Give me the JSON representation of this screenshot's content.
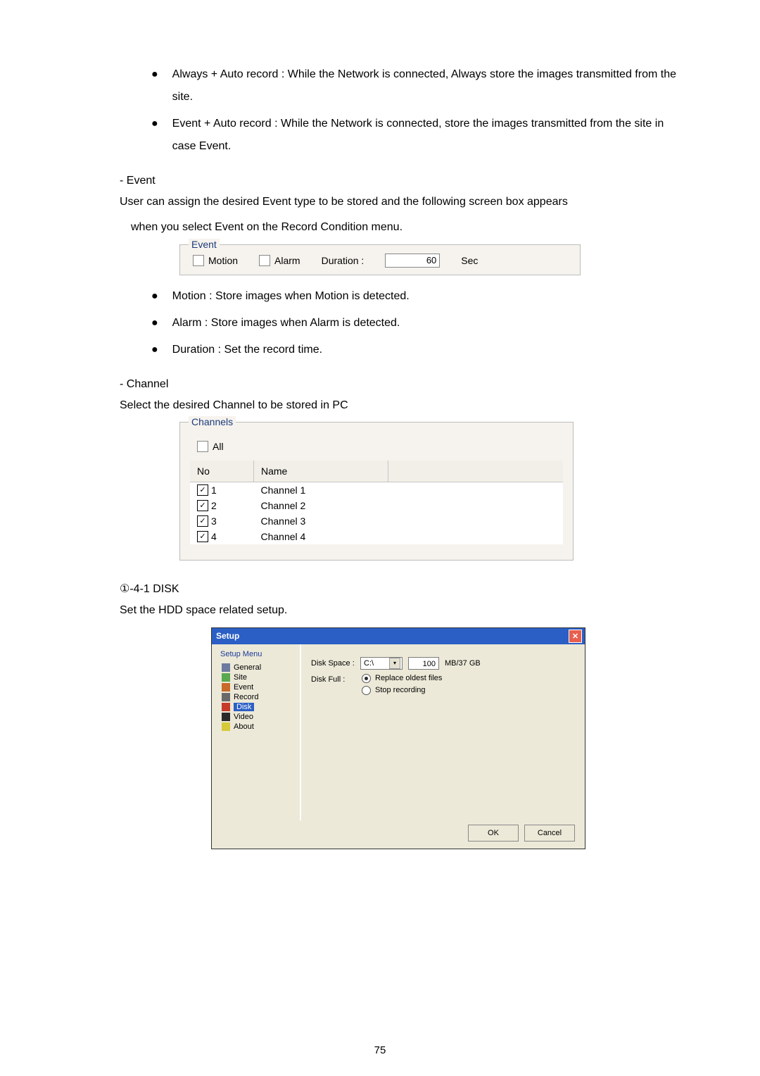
{
  "para1": "Always + Auto record : While the Network is connected, Always store the images transmitted from the site.",
  "para2": "Event + Auto record : While the Network is connected, store the images transmitted from the site in case Event.",
  "event": {
    "heading": "- Event",
    "desc1": "User can assign the desired Event type to be stored and the following screen box appears",
    "desc2": "when you select Event on the Record Condition menu.",
    "legend": "Event",
    "motion": "Motion",
    "alarm": "Alarm",
    "duration_label": "Duration :",
    "duration_value": "60",
    "duration_unit": "Sec",
    "b1": "Motion : Store images when Motion is detected.",
    "b2": "Alarm : Store images when Alarm is detected.",
    "b3": "Duration : Set the record time."
  },
  "channel": {
    "heading": "- Channel",
    "desc": "Select the desired Channel to be stored in PC",
    "legend": "Channels",
    "all": "All",
    "col_no": "No",
    "col_name": "Name",
    "rows": [
      {
        "no": "1",
        "name": "Channel 1"
      },
      {
        "no": "2",
        "name": "Channel 2"
      },
      {
        "no": "3",
        "name": "Channel 3"
      },
      {
        "no": "4",
        "name": "Channel 4"
      }
    ]
  },
  "disk": {
    "heading": "①-4-1 DISK",
    "desc": "Set the HDD space related setup.",
    "title": "Setup",
    "menu_title": "Setup Menu",
    "items": {
      "general": "General",
      "site": "Site",
      "event": "Event",
      "record": "Record",
      "disk": "Disk",
      "video": "Video",
      "about": "About"
    },
    "label_space": "Disk Space :",
    "drive": "C:\\",
    "space_value": "100",
    "space_unit": "MB/37 GB",
    "label_full": "Disk Full :",
    "radio_replace": "Replace oldest files",
    "radio_stop": "Stop recording",
    "ok": "OK",
    "cancel": "Cancel"
  },
  "page_no": "75"
}
